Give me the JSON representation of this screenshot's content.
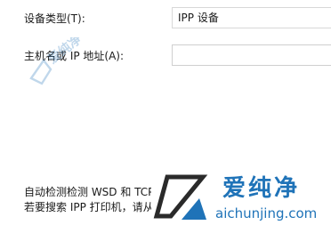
{
  "form": {
    "device_type_label": "设备类型(T):",
    "device_type_value": "IPP 设备",
    "host_label": "主机名或 IP 地址(A):",
    "host_value": "",
    "host_placeholder": ""
  },
  "description": {
    "line1": "自动检测检测 WSD 和 TCP/I",
    "line2": "若要搜索 IPP 打印机，请从下"
  },
  "watermark": {
    "left_text": "爱纯净",
    "brand_cn": "爱纯净",
    "brand_url": "aichunjing.com",
    "color": "#1f73b8"
  }
}
